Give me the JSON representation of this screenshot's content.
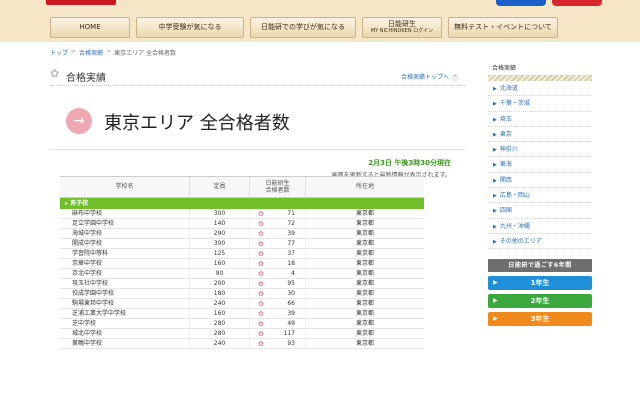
{
  "header": {
    "nav": [
      {
        "label": "HOME",
        "sub": ""
      },
      {
        "label": "中学受験が気になる",
        "sub": ""
      },
      {
        "label": "日能研での学びが気になる",
        "sub": ""
      },
      {
        "label": "日能研生",
        "sub": "MY NICHINOKEN ログイン"
      },
      {
        "label": "無料テスト・イベントについて",
        "sub": ""
      }
    ]
  },
  "breadcrumb": {
    "items": [
      "トップ",
      "合格実績",
      "東京エリア 全合格者数"
    ],
    "sep": ">"
  },
  "section": {
    "title": "合格実績",
    "top_link": "合格実績トップへ",
    "up_icon": "^"
  },
  "page": {
    "title": "東京エリア 全合格者数",
    "update_time": "2月3日 午後3時30分現在",
    "update_note": "画面を更新すると最新情報が表示されます。"
  },
  "table": {
    "headers": {
      "school": "学校名",
      "capacity": "定員",
      "passed": "日能研生\n合格者数",
      "location": "所在地"
    },
    "group": "▸ 男子校",
    "flower": "✿",
    "rows": [
      {
        "name": "麻布中学校",
        "capacity": "300",
        "passed": "71",
        "location": "東京都"
      },
      {
        "name": "足立学園中学校",
        "capacity": "140",
        "passed": "72",
        "location": "東京都"
      },
      {
        "name": "海城中学校",
        "capacity": "290",
        "passed": "39",
        "location": "東京都"
      },
      {
        "name": "開成中学校",
        "capacity": "300",
        "passed": "77",
        "location": "東京都"
      },
      {
        "name": "学習院中等科",
        "capacity": "125",
        "passed": "37",
        "location": "東京都"
      },
      {
        "name": "京華中学校",
        "capacity": "160",
        "passed": "18",
        "location": "東京都"
      },
      {
        "name": "京北中学校",
        "capacity": "90",
        "passed": "4",
        "location": "東京都"
      },
      {
        "name": "攻玉社中学校",
        "capacity": "200",
        "passed": "95",
        "location": "東京都"
      },
      {
        "name": "佼成学園中学校",
        "capacity": "180",
        "passed": "30",
        "location": "東京都"
      },
      {
        "name": "駒場東邦中学校",
        "capacity": "240",
        "passed": "66",
        "location": "東京都"
      },
      {
        "name": "芝浦工業大学中学校",
        "capacity": "160",
        "passed": "39",
        "location": "東京都"
      },
      {
        "name": "芝中学校",
        "capacity": "280",
        "passed": "49",
        "location": "東京都"
      },
      {
        "name": "城北中学校",
        "capacity": "280",
        "passed": "117",
        "location": "東京都"
      },
      {
        "name": "巣鴨中学校",
        "capacity": "240",
        "passed": "93",
        "location": "東京都"
      }
    ]
  },
  "sidebar": {
    "heading": "合格実績",
    "bullet": "▶",
    "items": [
      "北海道",
      "千葉・茨城",
      "埼玉",
      "東京",
      "神奈川",
      "東海",
      "関西",
      "広島・岡山",
      "四国",
      "九州・沖縄",
      "その他のエリア"
    ],
    "grade_heading": "日能研で過ごす6年間",
    "grades": [
      {
        "label": "1年生",
        "color": "#1e8fd8"
      },
      {
        "label": "2年生",
        "color": "#3aa83c"
      },
      {
        "label": "3年生",
        "color": "#f08a1c"
      }
    ],
    "grade_arrow": "▶"
  },
  "colors": {
    "accent_green": "#6fbf2a",
    "link_blue": "#2d6fb5",
    "time_green": "#3c9a1e",
    "flower_pink": "#e77fa2"
  }
}
